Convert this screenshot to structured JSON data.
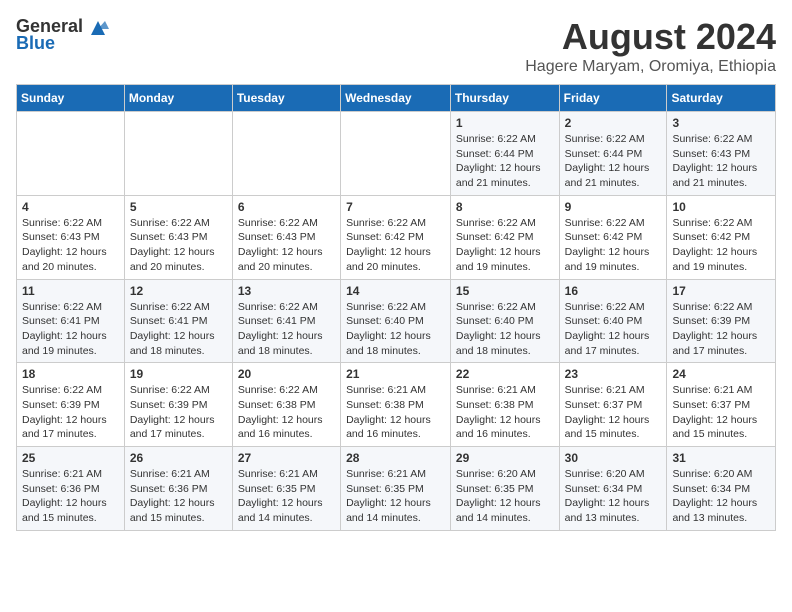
{
  "header": {
    "logo_general": "General",
    "logo_blue": "Blue",
    "month_year": "August 2024",
    "location": "Hagere Maryam, Oromiya, Ethiopia"
  },
  "days_of_week": [
    "Sunday",
    "Monday",
    "Tuesday",
    "Wednesday",
    "Thursday",
    "Friday",
    "Saturday"
  ],
  "weeks": [
    [
      {
        "day": "",
        "info": ""
      },
      {
        "day": "",
        "info": ""
      },
      {
        "day": "",
        "info": ""
      },
      {
        "day": "",
        "info": ""
      },
      {
        "day": "1",
        "info": "Sunrise: 6:22 AM\nSunset: 6:44 PM\nDaylight: 12 hours\nand 21 minutes."
      },
      {
        "day": "2",
        "info": "Sunrise: 6:22 AM\nSunset: 6:44 PM\nDaylight: 12 hours\nand 21 minutes."
      },
      {
        "day": "3",
        "info": "Sunrise: 6:22 AM\nSunset: 6:43 PM\nDaylight: 12 hours\nand 21 minutes."
      }
    ],
    [
      {
        "day": "4",
        "info": "Sunrise: 6:22 AM\nSunset: 6:43 PM\nDaylight: 12 hours\nand 20 minutes."
      },
      {
        "day": "5",
        "info": "Sunrise: 6:22 AM\nSunset: 6:43 PM\nDaylight: 12 hours\nand 20 minutes."
      },
      {
        "day": "6",
        "info": "Sunrise: 6:22 AM\nSunset: 6:43 PM\nDaylight: 12 hours\nand 20 minutes."
      },
      {
        "day": "7",
        "info": "Sunrise: 6:22 AM\nSunset: 6:42 PM\nDaylight: 12 hours\nand 20 minutes."
      },
      {
        "day": "8",
        "info": "Sunrise: 6:22 AM\nSunset: 6:42 PM\nDaylight: 12 hours\nand 19 minutes."
      },
      {
        "day": "9",
        "info": "Sunrise: 6:22 AM\nSunset: 6:42 PM\nDaylight: 12 hours\nand 19 minutes."
      },
      {
        "day": "10",
        "info": "Sunrise: 6:22 AM\nSunset: 6:42 PM\nDaylight: 12 hours\nand 19 minutes."
      }
    ],
    [
      {
        "day": "11",
        "info": "Sunrise: 6:22 AM\nSunset: 6:41 PM\nDaylight: 12 hours\nand 19 minutes."
      },
      {
        "day": "12",
        "info": "Sunrise: 6:22 AM\nSunset: 6:41 PM\nDaylight: 12 hours\nand 18 minutes."
      },
      {
        "day": "13",
        "info": "Sunrise: 6:22 AM\nSunset: 6:41 PM\nDaylight: 12 hours\nand 18 minutes."
      },
      {
        "day": "14",
        "info": "Sunrise: 6:22 AM\nSunset: 6:40 PM\nDaylight: 12 hours\nand 18 minutes."
      },
      {
        "day": "15",
        "info": "Sunrise: 6:22 AM\nSunset: 6:40 PM\nDaylight: 12 hours\nand 18 minutes."
      },
      {
        "day": "16",
        "info": "Sunrise: 6:22 AM\nSunset: 6:40 PM\nDaylight: 12 hours\nand 17 minutes."
      },
      {
        "day": "17",
        "info": "Sunrise: 6:22 AM\nSunset: 6:39 PM\nDaylight: 12 hours\nand 17 minutes."
      }
    ],
    [
      {
        "day": "18",
        "info": "Sunrise: 6:22 AM\nSunset: 6:39 PM\nDaylight: 12 hours\nand 17 minutes."
      },
      {
        "day": "19",
        "info": "Sunrise: 6:22 AM\nSunset: 6:39 PM\nDaylight: 12 hours\nand 17 minutes."
      },
      {
        "day": "20",
        "info": "Sunrise: 6:22 AM\nSunset: 6:38 PM\nDaylight: 12 hours\nand 16 minutes."
      },
      {
        "day": "21",
        "info": "Sunrise: 6:21 AM\nSunset: 6:38 PM\nDaylight: 12 hours\nand 16 minutes."
      },
      {
        "day": "22",
        "info": "Sunrise: 6:21 AM\nSunset: 6:38 PM\nDaylight: 12 hours\nand 16 minutes."
      },
      {
        "day": "23",
        "info": "Sunrise: 6:21 AM\nSunset: 6:37 PM\nDaylight: 12 hours\nand 15 minutes."
      },
      {
        "day": "24",
        "info": "Sunrise: 6:21 AM\nSunset: 6:37 PM\nDaylight: 12 hours\nand 15 minutes."
      }
    ],
    [
      {
        "day": "25",
        "info": "Sunrise: 6:21 AM\nSunset: 6:36 PM\nDaylight: 12 hours\nand 15 minutes."
      },
      {
        "day": "26",
        "info": "Sunrise: 6:21 AM\nSunset: 6:36 PM\nDaylight: 12 hours\nand 15 minutes."
      },
      {
        "day": "27",
        "info": "Sunrise: 6:21 AM\nSunset: 6:35 PM\nDaylight: 12 hours\nand 14 minutes."
      },
      {
        "day": "28",
        "info": "Sunrise: 6:21 AM\nSunset: 6:35 PM\nDaylight: 12 hours\nand 14 minutes."
      },
      {
        "day": "29",
        "info": "Sunrise: 6:20 AM\nSunset: 6:35 PM\nDaylight: 12 hours\nand 14 minutes."
      },
      {
        "day": "30",
        "info": "Sunrise: 6:20 AM\nSunset: 6:34 PM\nDaylight: 12 hours\nand 13 minutes."
      },
      {
        "day": "31",
        "info": "Sunrise: 6:20 AM\nSunset: 6:34 PM\nDaylight: 12 hours\nand 13 minutes."
      }
    ]
  ]
}
